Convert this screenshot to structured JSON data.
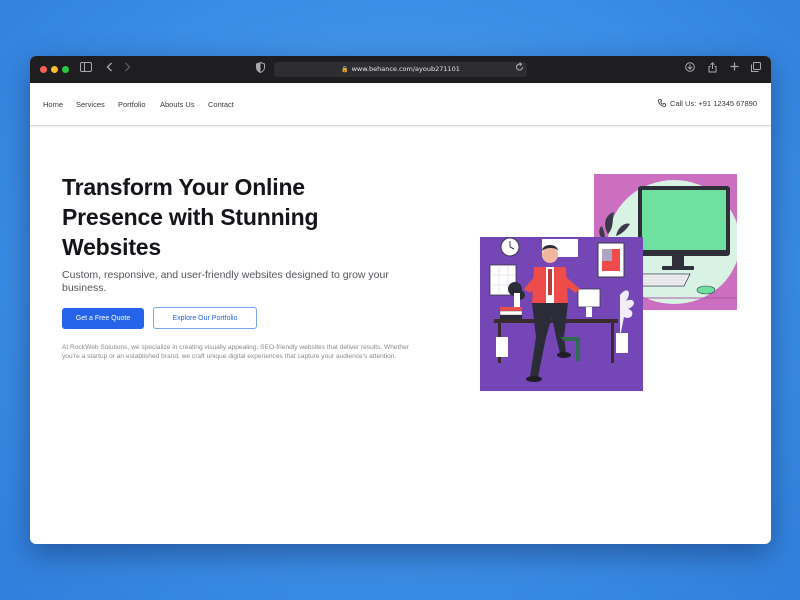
{
  "browser": {
    "url": "www.behance.com/ayoub271101"
  },
  "nav": {
    "links": [
      {
        "label": "Home"
      },
      {
        "label": "Services"
      },
      {
        "label": "Portfolio"
      },
      {
        "label": "Abouts Us"
      },
      {
        "label": "Contact"
      }
    ],
    "phone": "Call Us: +91 12345 67890"
  },
  "hero": {
    "title": "Transform Your Online Presence with Stunning Websites",
    "subtitle": "Custom, responsive, and user-friendly websites designed to grow your business.",
    "primary_button": "Get a Free Quote",
    "secondary_button": "Explore Our Portfolio",
    "description": "At RockWeb Solutions, we specialize in creating visually appealing, SEO-friendly websites that deliver results. Whether you're a startup or an established brand, we craft unique digital experiences that capture your audience's attention."
  },
  "colors": {
    "accent": "#2563eb",
    "background_blue": "#3d8fe6",
    "illustration_purple": "#7446b6",
    "illustration_pink": "#cc6fc0",
    "screen_green": "#6ee0a0"
  }
}
